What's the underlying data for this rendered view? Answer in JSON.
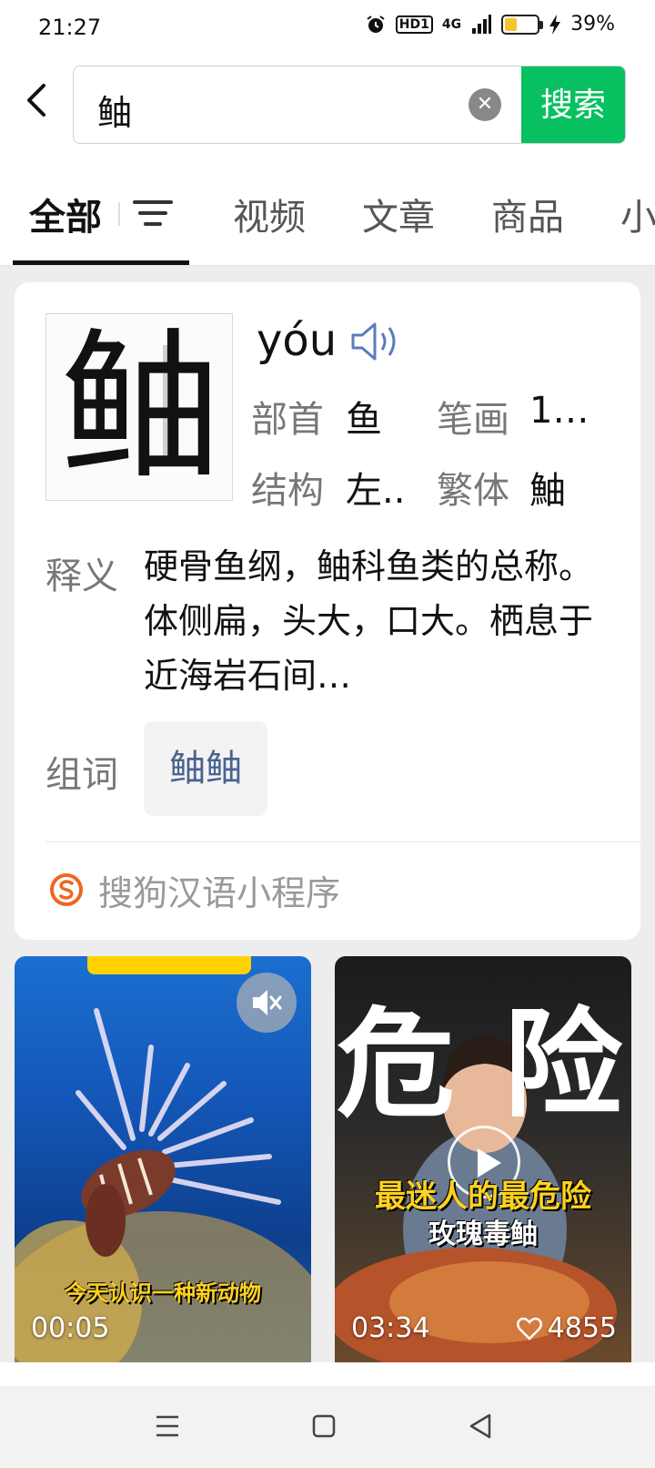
{
  "status_bar": {
    "time": "21:27",
    "network": "4G",
    "hd_label": "HD1",
    "battery_percent": "39%",
    "battery_level": 0.39
  },
  "search": {
    "query": "鲉",
    "button_label": "搜索"
  },
  "tabs": [
    {
      "label": "全部"
    },
    {
      "label": "视频"
    },
    {
      "label": "文章"
    },
    {
      "label": "商品"
    },
    {
      "label": "小"
    }
  ],
  "dictionary": {
    "character": "鲉",
    "pinyin": "yóu",
    "radical_label": "部首",
    "radical_value": "鱼",
    "strokes_label": "笔画",
    "strokes_value": "1…",
    "structure_label": "结构",
    "structure_value": "左..",
    "traditional_label": "繁体",
    "traditional_value": "鮋",
    "definition_label": "释义",
    "definition_text": "硬骨鱼纲，鲉科鱼类的总称。体侧扁，头大，口大。栖息于近海岩石间…",
    "words_label": "组词",
    "words": [
      "鲉鲉"
    ],
    "source": "搜狗汉语小程序"
  },
  "videos": [
    {
      "duration": "00:05",
      "caption": "今天认识一种新动物"
    },
    {
      "duration": "03:34",
      "likes": "4855",
      "title_left": "危",
      "title_right": "险",
      "caption_line1": "最迷人的最危险",
      "caption_line2": "玫瑰毒鲉"
    }
  ],
  "colors": {
    "accent_green": "#07c160",
    "link_blue": "#4a6490"
  }
}
